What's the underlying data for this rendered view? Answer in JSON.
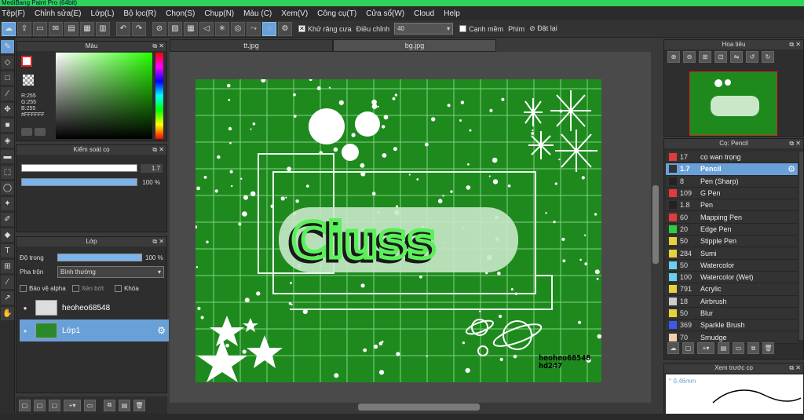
{
  "window": {
    "title": "MediBang Paint Pro (64bit)"
  },
  "menu": [
    "Tệp(F)",
    "Chỉnh sửa(E)",
    "Lớp(L)",
    "Bộ lọc(R)",
    "Chọn(S)",
    "Chụp(N)",
    "Màu (C)",
    "Xem(V)",
    "Công cụ(T)",
    "Cửa sổ(W)",
    "Cloud",
    "Help"
  ],
  "toolbar": {
    "antialias_label": "Khử răng cưa",
    "adjust_label": "Điều chỉnh",
    "adjust_value": "40",
    "canh_mem_label": "Cạnh mềm",
    "key_label": "Phím",
    "reset_label": "Đặt lại"
  },
  "color_panel": {
    "title": "Màu",
    "rgb": {
      "r": "R:255",
      "g": "G:255",
      "b": "B:255",
      "hex": "#FFFFFF"
    },
    "colors": {
      "foreground": "#ffffff",
      "accent": "#26ff00"
    }
  },
  "brush_control": {
    "title": "Kiểm soát cọ",
    "size_value": "1.7",
    "opacity_value": "100 %"
  },
  "layer_panel": {
    "title": "Lớp",
    "opacity_label": "Độ trong",
    "opacity_value": "100 %",
    "blend_label": "Pha trộn",
    "blend_value": "Bình thường",
    "protect_alpha": "Bảo vệ alpha",
    "clip": "Xén bớt",
    "lock": "Khóa",
    "layers": [
      {
        "name": "heoheo68548",
        "selected": false
      },
      {
        "name": "Lớp1",
        "selected": true
      }
    ]
  },
  "tabs": [
    {
      "label": "tt.jpg",
      "active": false
    },
    {
      "label": "bg.jpg",
      "active": true
    }
  ],
  "artwork": {
    "background": "#1e8a1e",
    "watermark_line1": "heoheo68548",
    "watermark_line2": "hd247"
  },
  "navigator": {
    "title": "Hoa tiêu"
  },
  "brush_panel": {
    "title": "Cọ: Pencil",
    "brushes": [
      {
        "size": "17",
        "name": "cọ wan trọng",
        "color": "#e23b3b",
        "selected": false
      },
      {
        "size": "1.7",
        "name": "Pencil",
        "color": "#333333",
        "selected": true
      },
      {
        "size": "8",
        "name": "Pen (Sharp)",
        "color": "#222222",
        "selected": false
      },
      {
        "size": "109",
        "name": "G Pen",
        "color": "#e23b3b",
        "selected": false
      },
      {
        "size": "1.8",
        "name": "Pen",
        "color": "#222222",
        "selected": false
      },
      {
        "size": "60",
        "name": "Mapping Pen",
        "color": "#e23b3b",
        "selected": false
      },
      {
        "size": "20",
        "name": "Edge Pen",
        "color": "#2ecc40",
        "selected": false
      },
      {
        "size": "50",
        "name": "Stipple Pen",
        "color": "#e8d23a",
        "selected": false
      },
      {
        "size": "284",
        "name": "Sumi",
        "color": "#e8d23a",
        "selected": false
      },
      {
        "size": "50",
        "name": "Watercolor",
        "color": "#6ad0f0",
        "selected": false
      },
      {
        "size": "100",
        "name": "Watercolor (Wet)",
        "color": "#6ad0f0",
        "selected": false
      },
      {
        "size": "791",
        "name": "Acrylic",
        "color": "#e8d23a",
        "selected": false
      },
      {
        "size": "18",
        "name": "Airbrush",
        "color": "#cccccc",
        "selected": false
      },
      {
        "size": "50",
        "name": "Blur",
        "color": "#e8d23a",
        "selected": false
      },
      {
        "size": "369",
        "name": "Sparkle Brush",
        "color": "#3a5ae8",
        "selected": false
      },
      {
        "size": "70",
        "name": "Smudge",
        "color": "#f0d0b0",
        "selected": false
      }
    ]
  },
  "preview_panel": {
    "title": "Xem trước cọ",
    "size": "0.46mm"
  }
}
